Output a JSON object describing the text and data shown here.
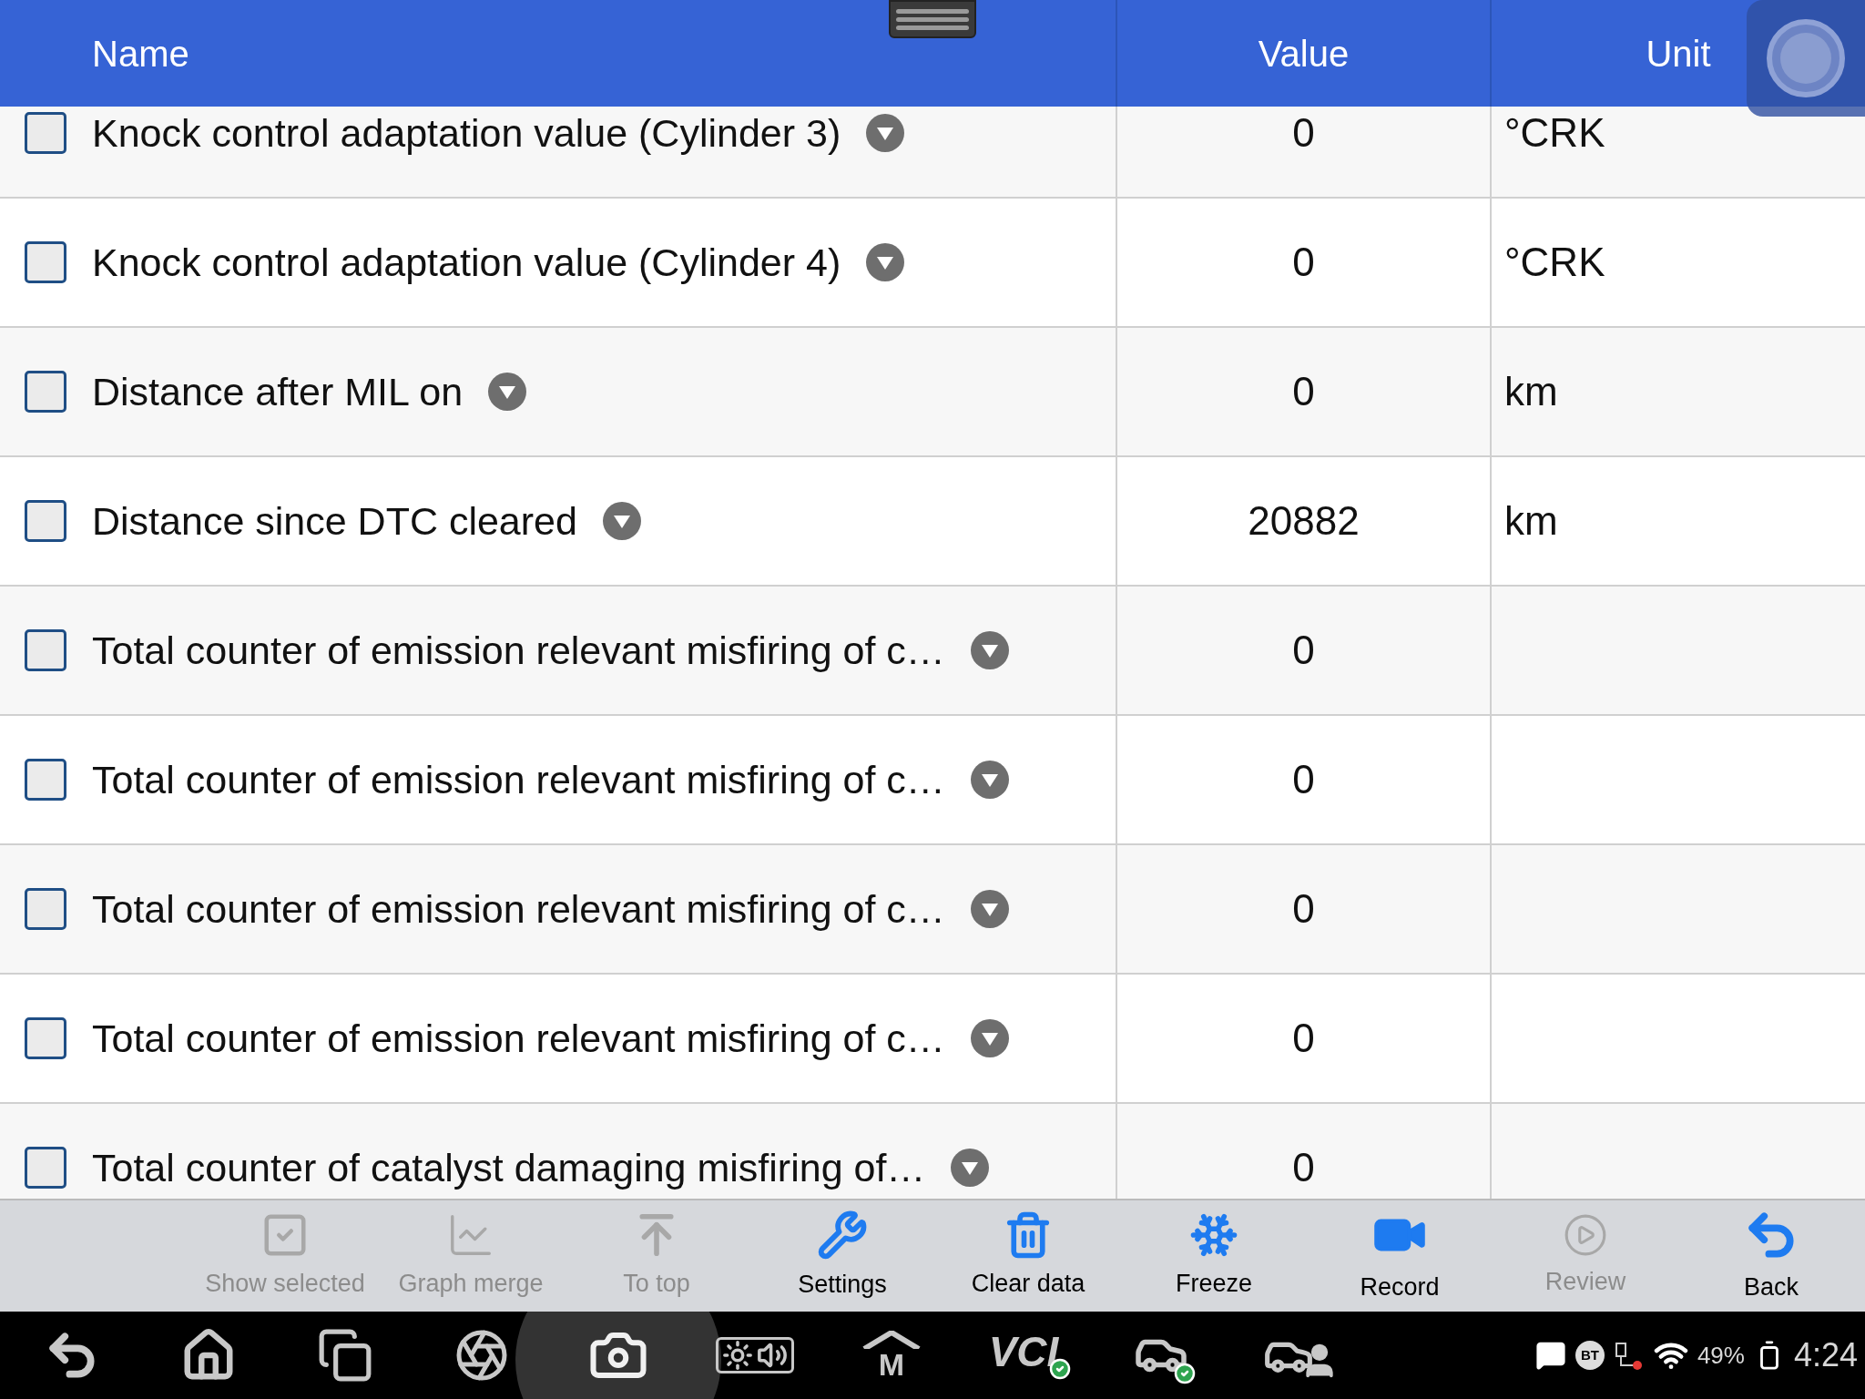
{
  "table": {
    "columns": [
      {
        "label": "Name"
      },
      {
        "label": "Value"
      },
      {
        "label": "Unit"
      }
    ],
    "rows": [
      {
        "name": "Knock control adaptation value (Cylinder 3)",
        "checked": false,
        "value": "0",
        "unit": "°CRK"
      },
      {
        "name": "Knock control adaptation value (Cylinder 4)",
        "checked": false,
        "value": "0",
        "unit": "°CRK"
      },
      {
        "name": "Distance after MIL on",
        "checked": false,
        "value": "0",
        "unit": "km"
      },
      {
        "name": "Distance since DTC cleared",
        "checked": false,
        "value": "20882",
        "unit": "km"
      },
      {
        "name": "Total counter of emission relevant misfiring of c…",
        "checked": false,
        "value": "0"
      },
      {
        "name": "Total counter of emission relevant misfiring of c…",
        "checked": false,
        "value": "0"
      },
      {
        "name": "Total counter of emission relevant misfiring of c…",
        "checked": false,
        "value": "0"
      },
      {
        "name": "Total counter of emission relevant misfiring of c…",
        "checked": false,
        "value": "0"
      },
      {
        "name": "Total counter of catalyst damaging misfiring of…",
        "checked": false,
        "value": "0"
      }
    ]
  },
  "toolbar": [
    {
      "kind": "show-selected",
      "label": "Show selected",
      "disabled": true
    },
    {
      "kind": "graph",
      "label": "Graph merge",
      "disabled": true
    },
    {
      "kind": "top",
      "label": "To top",
      "disabled": true
    },
    {
      "kind": "settings",
      "label": "Settings",
      "disabled": false
    },
    {
      "kind": "clear",
      "label": "Clear data",
      "disabled": false
    },
    {
      "kind": "freeze",
      "label": "Freeze",
      "disabled": false
    },
    {
      "kind": "record",
      "label": "Record",
      "disabled": false
    },
    {
      "kind": "review",
      "label": "Review",
      "disabled": true
    },
    {
      "kind": "back",
      "label": "Back",
      "disabled": false
    }
  ],
  "nav_bar": {
    "items": [
      {
        "kind": "back"
      },
      {
        "kind": "home"
      },
      {
        "kind": "recent"
      },
      {
        "kind": "browser"
      },
      {
        "kind": "camera"
      },
      {
        "kind": "display"
      },
      {
        "kind": "maxifix",
        "text": "M"
      },
      {
        "kind": "vci",
        "text": "VCI"
      },
      {
        "kind": "car"
      },
      {
        "kind": "remote"
      }
    ],
    "status": {
      "bt": "BT",
      "battery": "49%",
      "time": "4:24"
    }
  }
}
